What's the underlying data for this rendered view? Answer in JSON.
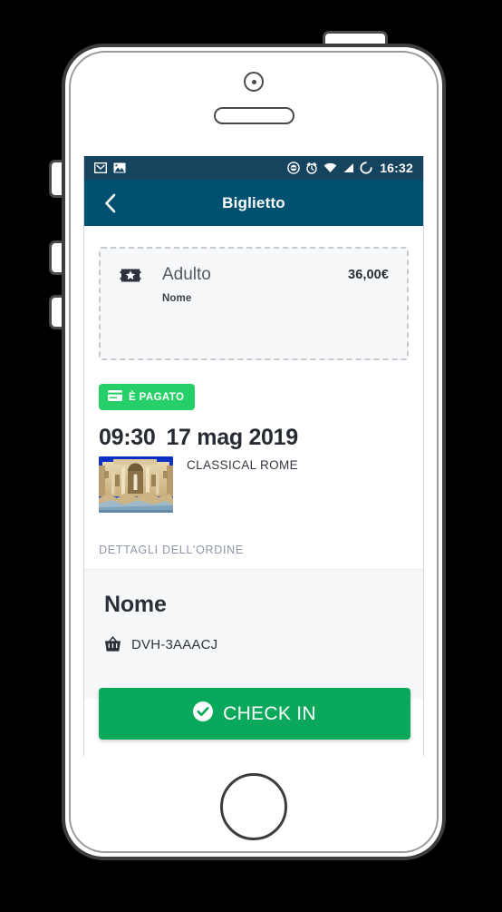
{
  "device": {
    "name": "smartphone-mockup",
    "camera": "camera-icon",
    "speaker": "speaker-grille",
    "home_button": "home-button",
    "buttons": [
      "silent-switch",
      "volume-up-button",
      "volume-down-button",
      "power-button"
    ]
  },
  "status_bar": {
    "background": "#16435e",
    "left_icons": [
      "gmail-icon",
      "image-icon"
    ],
    "right_icons": [
      "do-not-disturb-icon",
      "alarm-icon",
      "wifi-icon",
      "signal-icon",
      "sync-icon"
    ],
    "time": "16:32"
  },
  "app_bar": {
    "background": "#00516f",
    "back_icon": "chevron-left-icon",
    "title": "Biglietto"
  },
  "ticket_card": {
    "icon": "ticket-star-icon",
    "type": "Adulto",
    "price": "36,00€",
    "holder_label": "Nome"
  },
  "paid_badge": {
    "icon": "credit-card-icon",
    "label": "È PAGATO",
    "color": "#27cf68"
  },
  "event": {
    "time": "09:30",
    "date": "17 mag 2019",
    "thumbnail": "trevi-fountain-photo",
    "title": "CLASSICAL ROME"
  },
  "order": {
    "section_label": "DETTAGLI DELL'ORDINE",
    "name": "Nome",
    "code_icon": "basket-icon",
    "code": "DVH-3AAACJ"
  },
  "checkin": {
    "icon": "check-circle-icon",
    "label": "CHECK IN",
    "color": "#0aa85a"
  }
}
